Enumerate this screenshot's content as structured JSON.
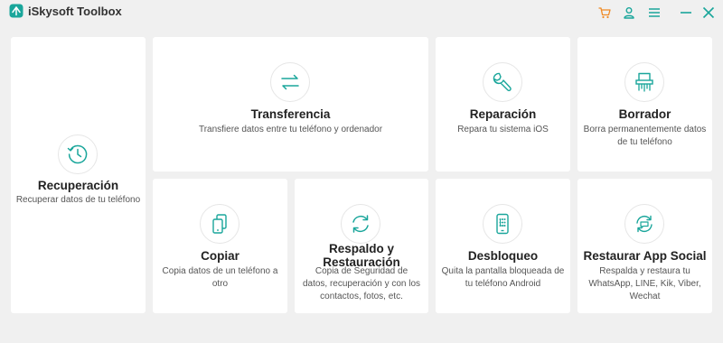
{
  "app": {
    "title": "iSkysoft Toolbox",
    "accent_color": "#1aa69b",
    "cart_color": "#f08a24"
  },
  "titlebar": {
    "icons": [
      "cart-icon",
      "user-icon",
      "menu-icon",
      "minimize-icon",
      "close-icon"
    ]
  },
  "cards": {
    "recuperacion": {
      "title": "Recuperación",
      "desc": "Recuperar datos de tu teléfono",
      "icon": "clock-recovery-icon"
    },
    "transferencia": {
      "title": "Transferencia",
      "desc": "Transfiere datos entre tu teléfono y ordenador",
      "icon": "transfer-arrows-icon"
    },
    "reparacion": {
      "title": "Reparación",
      "desc": "Repara tu sistema iOS",
      "icon": "wrench-icon"
    },
    "borrador": {
      "title": "Borrador",
      "desc": "Borra permanentemente datos de tu teléfono",
      "icon": "shredder-icon"
    },
    "copiar": {
      "title": "Copiar",
      "desc": "Copia datos de un teléfono a otro",
      "icon": "phone-copy-icon"
    },
    "respaldo": {
      "title": "Respaldo y Restauración",
      "desc": "Copia de Seguridad de datos, recuperación y con los contactos, fotos, etc.",
      "icon": "backup-restore-icon"
    },
    "desbloqueo": {
      "title": "Desbloqueo",
      "desc": "Quita la pantalla bloqueada de tu teléfono Android",
      "icon": "phone-unlock-icon"
    },
    "restaurar_social": {
      "title": "Restaurar App Social",
      "desc": "Respalda y restaura tu WhatsApp, LINE, Kik, Viber, Wechat",
      "icon": "social-restore-icon"
    }
  }
}
